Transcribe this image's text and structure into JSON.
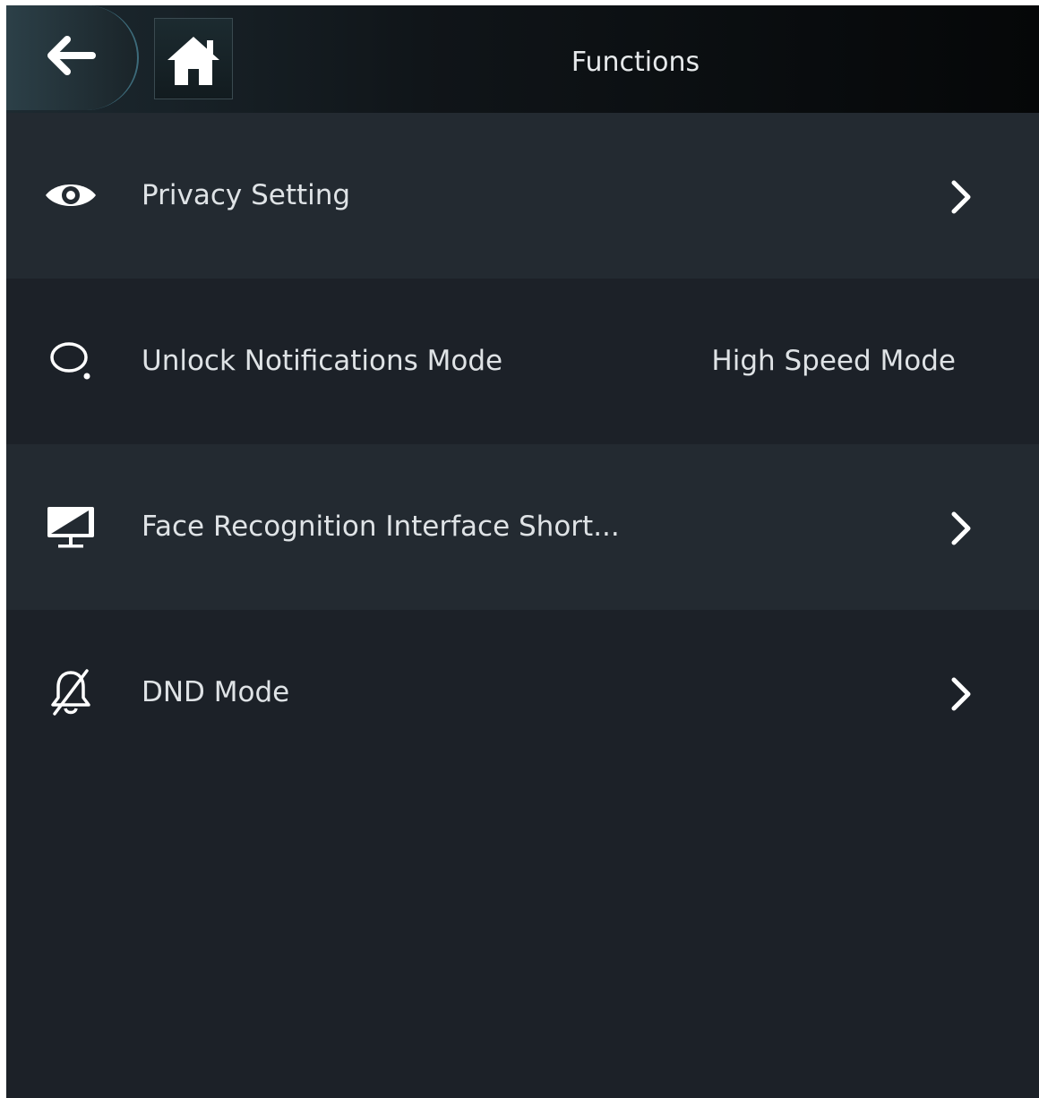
{
  "header": {
    "title": "Functions",
    "back_icon": "arrow-left-icon",
    "home_icon": "home-icon"
  },
  "menu": {
    "items": [
      {
        "icon": "eye-icon",
        "label": "Privacy Setting",
        "value": "",
        "has_chevron": true
      },
      {
        "icon": "chat-bubble-icon",
        "label": "Unlock Notifications Mode",
        "value": "High Speed Mode",
        "has_chevron": false
      },
      {
        "icon": "monitor-icon",
        "label": "Face Recognition Interface Short...",
        "value": "",
        "has_chevron": true
      },
      {
        "icon": "bell-off-icon",
        "label": "DND Mode",
        "value": "",
        "has_chevron": true
      }
    ]
  },
  "colors": {
    "background": "#1c2128",
    "row_alt": "#232a31",
    "text": "#dfe3e6",
    "accent_border": "#3d6b7a"
  }
}
